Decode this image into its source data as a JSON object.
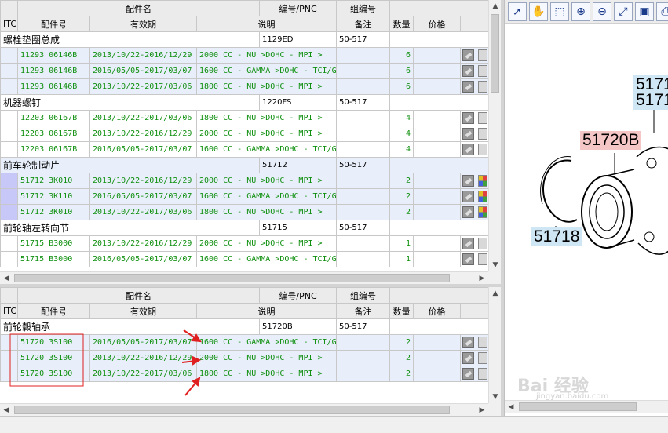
{
  "columns_top": {
    "name": "配件名",
    "pnc": "编号/PNC",
    "group": "组编号"
  },
  "columns": {
    "itc": "ITC",
    "part_no": "配件号",
    "validity": "有效期",
    "desc": "说明",
    "remark": "备注",
    "qty": "数量",
    "price": "价格"
  },
  "top_grid": {
    "groups": [
      {
        "name": "螺栓垫圈总成",
        "pnc": "1129ED",
        "group_code": "50-517",
        "rows": [
          {
            "part": "11293 06146B",
            "date": "2013/10/22-2016/12/29",
            "desc": "2000 CC - NU >DOHC - MPI >",
            "qty": "6"
          },
          {
            "part": "11293 06146B",
            "date": "2016/05/05-2017/03/07",
            "desc": "1600 CC - GAMMA >DOHC - TCI/G",
            "qty": "6"
          },
          {
            "part": "11293 06146B",
            "date": "2013/10/22-2017/03/06",
            "desc": "1800 CC - NU >DOHC - MPI >",
            "qty": "6"
          }
        ]
      },
      {
        "name": "机器螺钉",
        "pnc": "1220FS",
        "group_code": "50-517",
        "rows": [
          {
            "part": "12203 06167B",
            "date": "2013/10/22-2017/03/06",
            "desc": "1800 CC - NU >DOHC - MPI >",
            "qty": "4"
          },
          {
            "part": "12203 06167B",
            "date": "2013/10/22-2016/12/29",
            "desc": "2000 CC - NU >DOHC - MPI >",
            "qty": "4"
          },
          {
            "part": "12203 06167B",
            "date": "2016/05/05-2017/03/07",
            "desc": "1600 CC - GAMMA >DOHC - TCI/G",
            "qty": "4"
          }
        ]
      },
      {
        "name": "前车轮制动片",
        "pnc": "51712",
        "group_code": "50-517",
        "rows": [
          {
            "part": "51712 3K010",
            "date": "2013/10/22-2016/12/29",
            "desc": "2000 CC - NU >DOHC - MPI >",
            "qty": "2"
          },
          {
            "part": "51712 3K110",
            "date": "2016/05/05-2017/03/07",
            "desc": "1600 CC - GAMMA >DOHC - TCI/G",
            "qty": "2"
          },
          {
            "part": "51712 3K010",
            "date": "2013/10/22-2017/03/06",
            "desc": "1800 CC - NU >DOHC - MPI >",
            "qty": "2"
          }
        ]
      },
      {
        "name": "前轮轴左转向节",
        "pnc": "51715",
        "group_code": "50-517",
        "rows": [
          {
            "part": "51715 B3000",
            "date": "2013/10/22-2016/12/29",
            "desc": "2000 CC - NU >DOHC - MPI >",
            "qty": "1"
          },
          {
            "part": "51715 B3000",
            "date": "2016/05/05-2017/03/07",
            "desc": "1600 CC - GAMMA >DOHC - TCI/G",
            "qty": "1"
          }
        ]
      }
    ]
  },
  "bottom_grid": {
    "group": {
      "name": "前轮毂轴承",
      "pnc": "51720B",
      "group_code": "50-517"
    },
    "rows": [
      {
        "part": "51720 3S100",
        "date": "2016/05/05-2017/03/07",
        "desc": "1600 CC - GAMMA >DOHC - TCI/G",
        "qty": "2"
      },
      {
        "part": "51720 3S100",
        "date": "2013/10/22-2016/12/29",
        "desc": "2000 CC - NU >DOHC - MPI >",
        "qty": "2"
      },
      {
        "part": "51720 3S100",
        "date": "2013/10/22-2017/03/06",
        "desc": "1800 CC - NU >DOHC - MPI >",
        "qty": "2"
      }
    ]
  },
  "toolbar": [
    {
      "icon": "pointer-icon",
      "glyph": "➚"
    },
    {
      "icon": "hand-pan-icon",
      "glyph": "✋"
    },
    {
      "icon": "zoom-box-icon",
      "glyph": "⬚"
    },
    {
      "icon": "zoom-in-icon",
      "glyph": "⊕"
    },
    {
      "icon": "zoom-out-icon",
      "glyph": "⊖"
    },
    {
      "icon": "fit-screen-icon",
      "glyph": "⤢"
    },
    {
      "icon": "save-icon",
      "glyph": "▣"
    },
    {
      "icon": "print-icon",
      "glyph": "⎙"
    }
  ],
  "diagram": {
    "callouts": [
      {
        "text": "5171",
        "style": "blue"
      },
      {
        "text": "5171",
        "style": "blue"
      },
      {
        "text": "51720B",
        "style": "red"
      },
      {
        "text": "51718",
        "style": "blue"
      }
    ],
    "watermark_text": "Bai 经验",
    "watermark_url": "jingyan.baidu.com"
  },
  "colors": {
    "part_text": "#109010",
    "row_alt": "#e8eefa",
    "selected": "#c8c8f8",
    "annotation": "#e02020"
  }
}
